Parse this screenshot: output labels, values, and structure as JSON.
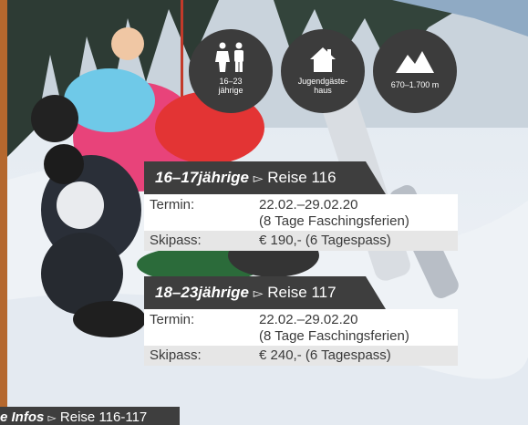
{
  "badges": [
    {
      "icon": "people-icon",
      "line1": "16–23",
      "line2": "jährige"
    },
    {
      "icon": "house-icon",
      "line1": "Jugendgäste-",
      "line2": "haus"
    },
    {
      "icon": "mountain-icon",
      "line1": "670–1.700 m",
      "line2": ""
    }
  ],
  "trips": [
    {
      "age": "16–17jährige",
      "arrow": "▻",
      "trip": "Reise 116",
      "termin_label": "Termin:",
      "termin_line1": "22.02.–29.02.20",
      "termin_line2": "(8 Tage Faschingsferien)",
      "skipass_label": "Skipass:",
      "skipass_value": "€ 190,- (6 Tagespass)"
    },
    {
      "age": "18–23jährige",
      "arrow": "▻",
      "trip": "Reise 117",
      "termin_label": "Termin:",
      "termin_line1": "22.02.–29.02.20",
      "termin_line2": "(8 Tage Faschingsferien)",
      "skipass_label": "Skipass:",
      "skipass_value": "€ 240,- (6 Tagespass)"
    }
  ],
  "footer": {
    "bold": "e Infos",
    "arrow": "▻",
    "text": "Reise 116-117"
  },
  "colors": {
    "badge": "#3c3c3c",
    "header": "#3e3e3e",
    "stripe": "#e6e6e6"
  }
}
